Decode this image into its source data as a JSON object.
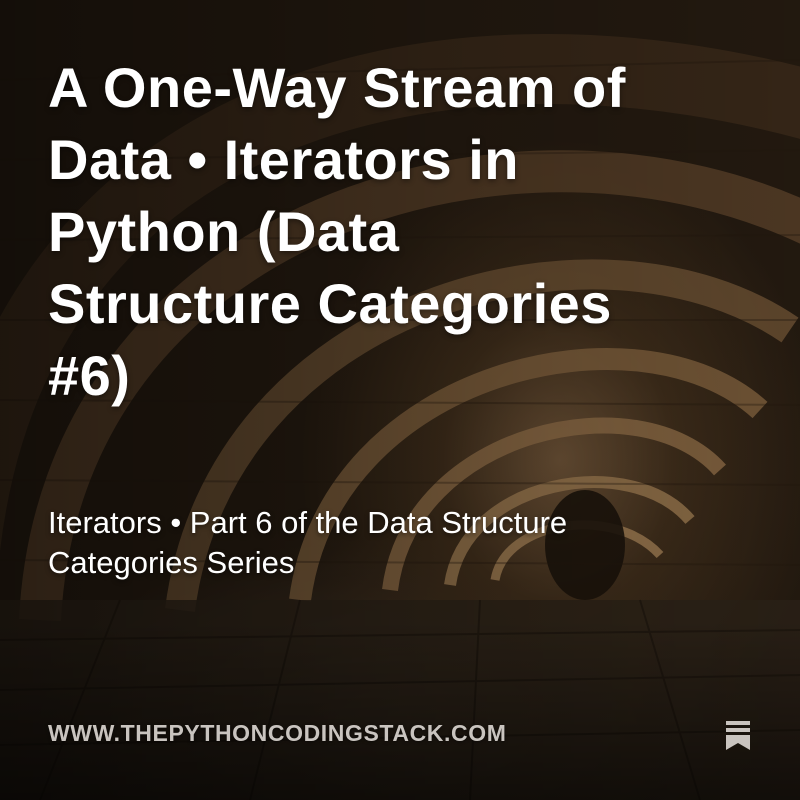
{
  "post": {
    "title": "A One-Way Stream of Data • Iterators in Python (Data Structure Categories #6)",
    "subtitle": "Iterators • Part 6 of the Data Structure Categories Series",
    "site_url": "WWW.THEPYTHONCODINGSTACK.COM"
  },
  "icons": {
    "publisher_logo": "substack-bookmark-icon"
  },
  "colors": {
    "title_text": "#ffffff",
    "url_text": "#c9c4bf",
    "logo": "#c9c4bf"
  }
}
